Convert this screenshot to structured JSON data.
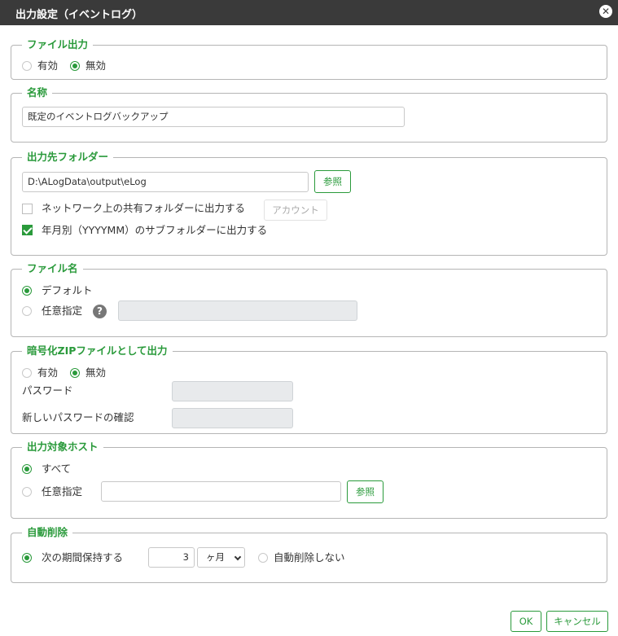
{
  "dialog": {
    "title": "出力設定（イベントログ）"
  },
  "file_output": {
    "legend": "ファイル出力",
    "enabled_label": "有効",
    "disabled_label": "無効",
    "selected": "無効"
  },
  "name": {
    "legend": "名称",
    "value": "既定のイベントログバックアップ"
  },
  "output_folder": {
    "legend": "出力先フォルダー",
    "path": "D:\\ALogData\\output\\eLog",
    "browse_label": "参照",
    "network_share_label": "ネットワーク上の共有フォルダーに出力する",
    "network_share_checked": false,
    "account_label": "アカウント",
    "subfolder_label": "年月別（YYYYMM）のサブフォルダーに出力する",
    "subfolder_checked": true
  },
  "file_name": {
    "legend": "ファイル名",
    "default_label": "デフォルト",
    "custom_label": "任意指定",
    "selected": "デフォルト",
    "custom_value": ""
  },
  "zip": {
    "legend": "暗号化ZIPファイルとして出力",
    "enabled_label": "有効",
    "disabled_label": "無効",
    "selected": "無効",
    "password_label": "パスワード",
    "confirm_label": "新しいパスワードの確認"
  },
  "target_host": {
    "legend": "出力対象ホスト",
    "all_label": "すべて",
    "custom_label": "任意指定",
    "selected": "すべて",
    "custom_value": "",
    "browse_label": "参照"
  },
  "auto_delete": {
    "legend": "自動削除",
    "keep_label": "次の期間保持する",
    "period_value": "3",
    "period_unit": "ヶ月",
    "no_delete_label": "自動削除しない",
    "selected": "次の期間保持する"
  },
  "footer": {
    "ok_label": "OK",
    "cancel_label": "キャンセル"
  },
  "colors": {
    "accent": "#2a9a3b",
    "titlebar": "#3a3a3a",
    "border": "#b5b5b5",
    "disabled_field": "#e8eaec"
  }
}
